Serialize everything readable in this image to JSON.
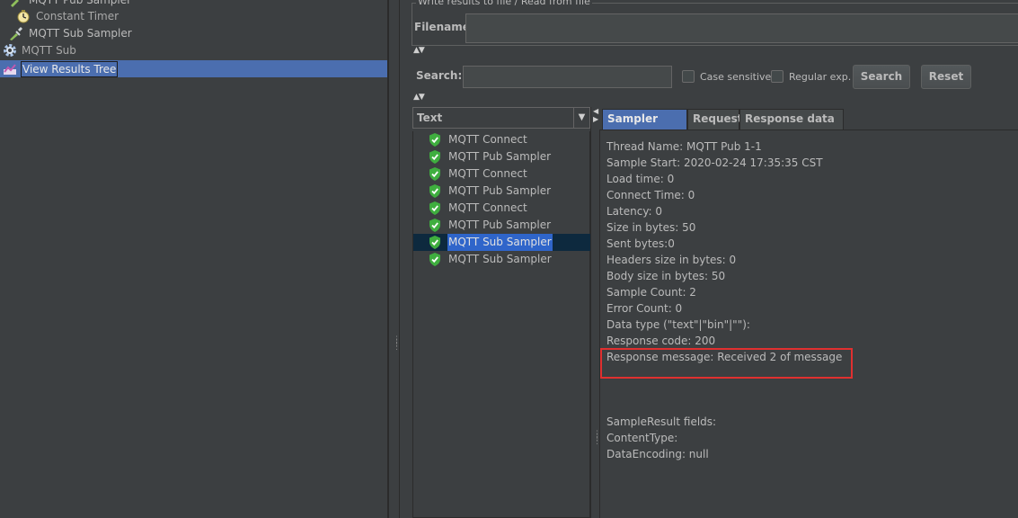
{
  "tree": {
    "items": [
      {
        "label": "MQTT Pub Sampler"
      },
      {
        "label": "Constant Timer"
      },
      {
        "label": "MQTT Sub Sampler"
      },
      {
        "label": "MQTT Sub"
      },
      {
        "label": "View Results Tree"
      }
    ]
  },
  "file_panel": {
    "legend": "Write results to file / Read from file",
    "filename_label": "Filename",
    "filename_value": ""
  },
  "search": {
    "label": "Search:",
    "value": "",
    "case_sensitive_label": "Case sensitive",
    "regex_label": "Regular exp.",
    "search_button": "Search",
    "reset_button": "Reset"
  },
  "renderer": {
    "selected": "Text"
  },
  "results_list": [
    {
      "label": "MQTT Connect",
      "selected": false
    },
    {
      "label": "MQTT Pub Sampler",
      "selected": false
    },
    {
      "label": "MQTT Connect",
      "selected": false
    },
    {
      "label": "MQTT Pub Sampler",
      "selected": false
    },
    {
      "label": "MQTT Connect",
      "selected": false
    },
    {
      "label": "MQTT Pub Sampler",
      "selected": false
    },
    {
      "label": "MQTT Sub Sampler",
      "selected": true
    },
    {
      "label": "MQTT Sub Sampler",
      "selected": false
    }
  ],
  "tabs": [
    {
      "label": "Sampler result",
      "active": true
    },
    {
      "label": "Request",
      "active": false
    },
    {
      "label": "Response data",
      "active": false
    }
  ],
  "sampler_result": {
    "lines": [
      "Thread Name: MQTT Pub 1-1",
      "Sample Start: 2020-02-24 17:35:35 CST",
      "Load time: 0",
      "Connect Time: 0",
      "Latency: 0",
      "Size in bytes: 50",
      "Sent bytes:0",
      "Headers size in bytes: 0",
      "Body size in bytes: 50",
      "Sample Count: 2",
      "Error Count: 0",
      "Data type (\"text\"|\"bin\"|\"\"):",
      "Response code: 200",
      "Response message: Received 2 of message",
      "",
      "",
      "SampleResult fields:",
      "ContentType:",
      "DataEncoding: null"
    ]
  },
  "colors": {
    "background": "#3c3f41",
    "selection": "#4b6eaf",
    "success": "#3fae3f",
    "highlight_box": "#e03030"
  }
}
